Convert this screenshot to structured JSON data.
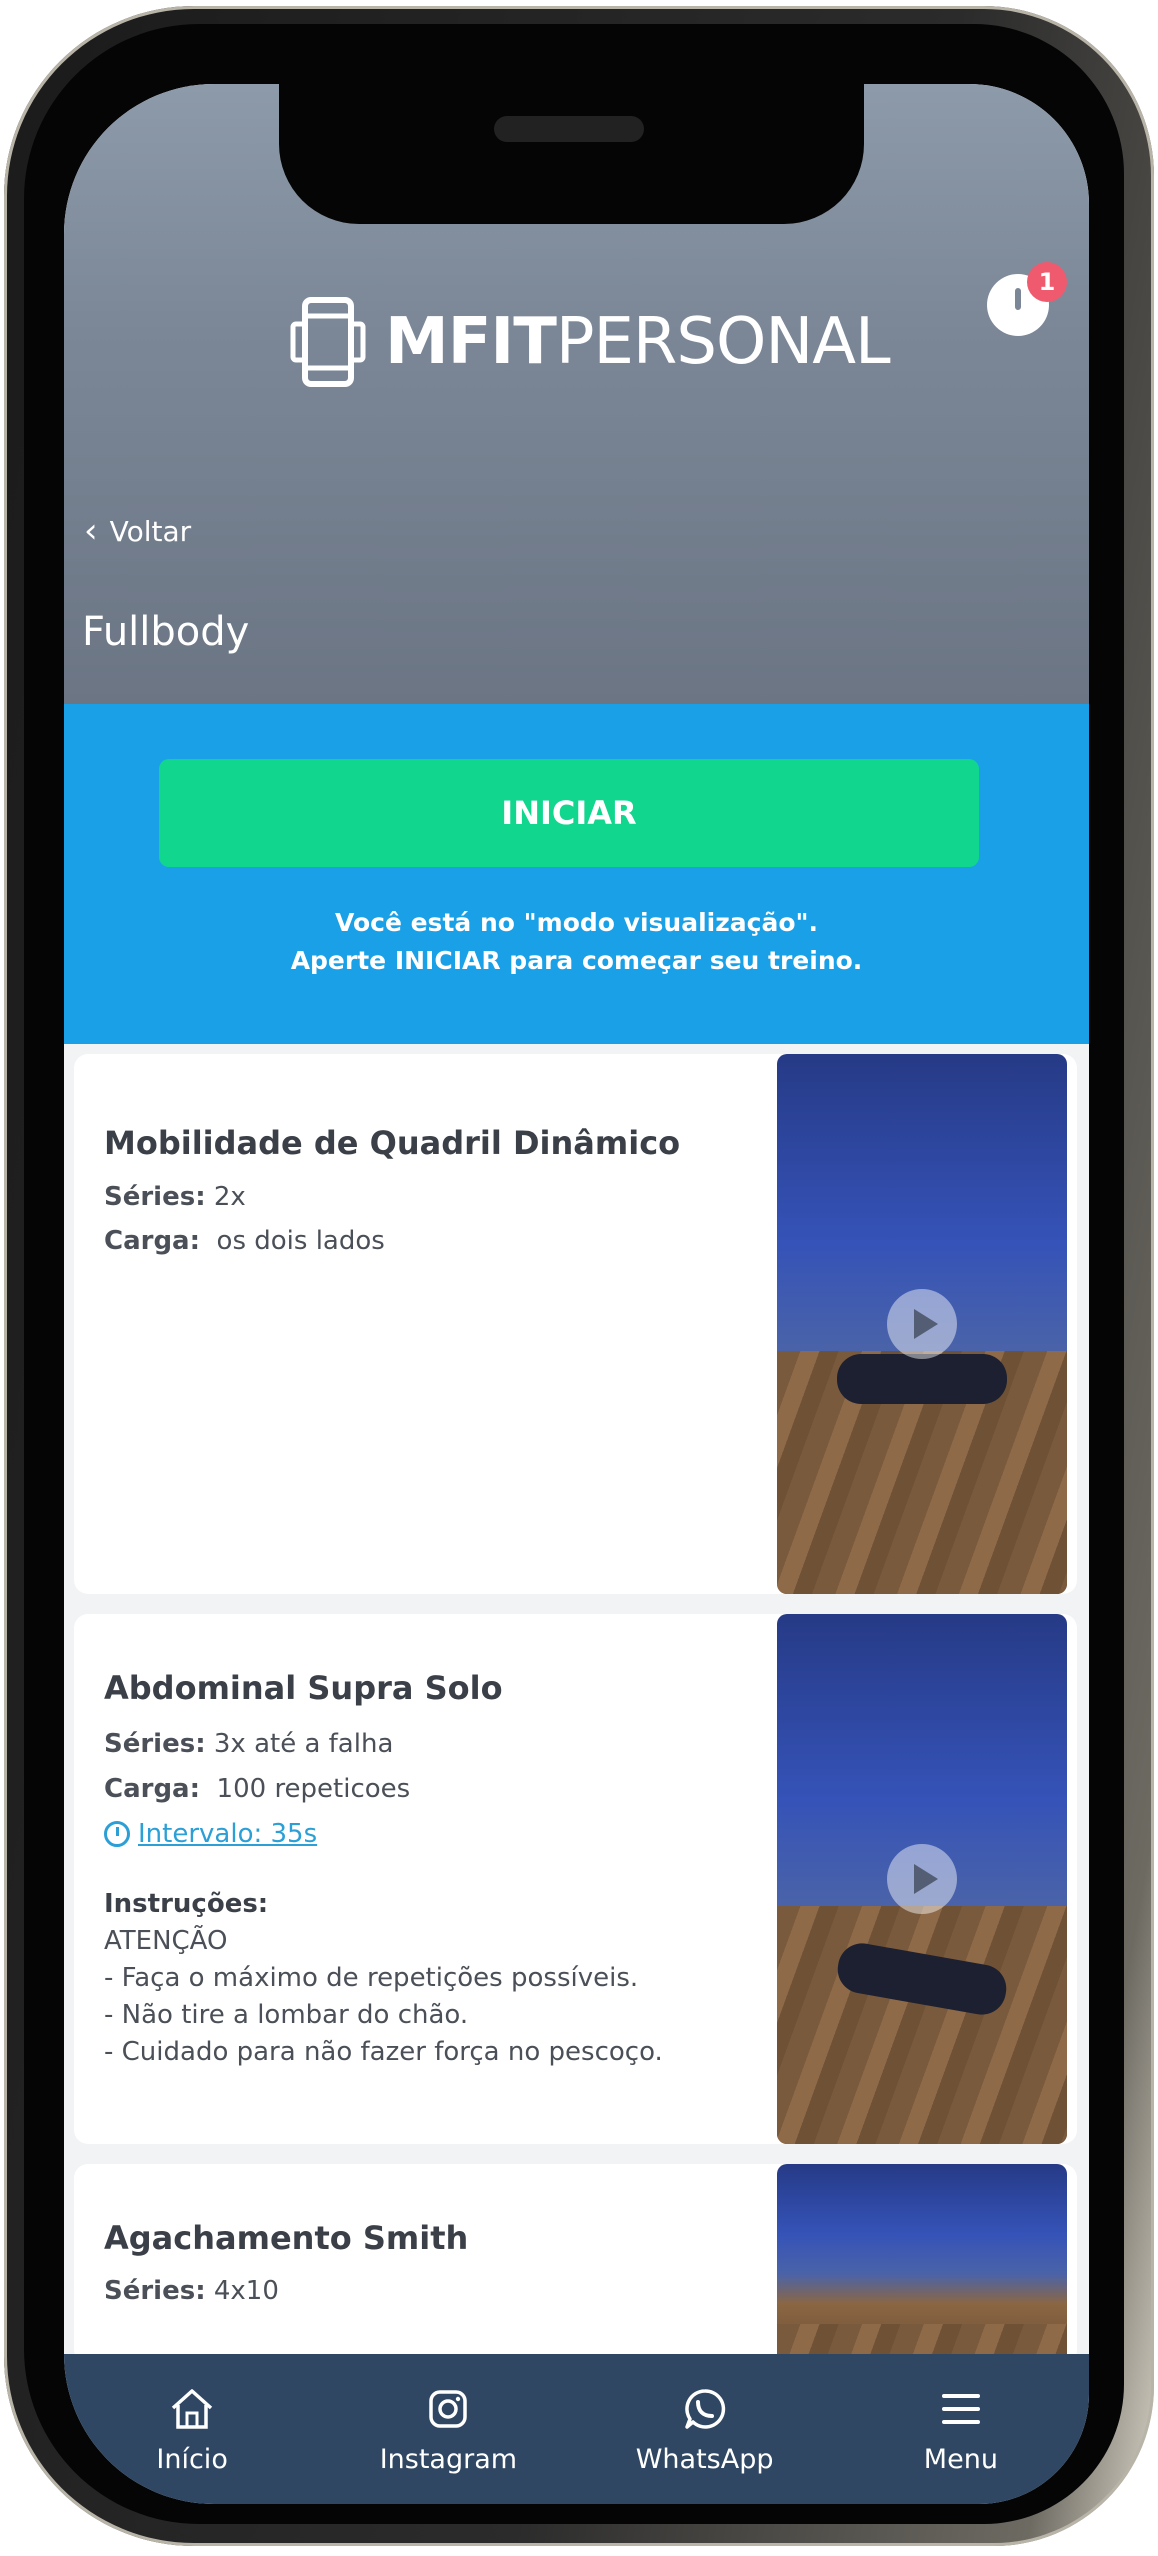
{
  "header": {
    "logo_bold": "MFIT",
    "logo_light": "PERSONAL",
    "notification_count": "1",
    "back_label": "Voltar",
    "page_title": "Fullbody"
  },
  "cta": {
    "start_label": "INICIAR",
    "message_line1": "Você está no \"modo visualização\".",
    "message_line2": "Aperte INICIAR para começar seu treino."
  },
  "exercises": [
    {
      "name": "Mobilidade de Quadril Dinâmico",
      "series_label": "Séries:",
      "series_value": "2x",
      "load_label": "Carga:",
      "load_value": "os dois lados"
    },
    {
      "name": "Abdominal Supra Solo",
      "series_label": "Séries:",
      "series_value": "3x até a falha",
      "load_label": "Carga:",
      "load_value": "100 repeticoes",
      "interval": "Intervalo: 35s",
      "instructions_label": "Instruções:",
      "instructions": [
        "ATENÇÃO",
        "- Faça o máximo de repetições possíveis.",
        "- Não tire a lombar do chão.",
        "- Cuidado para não fazer força no pescoço."
      ]
    },
    {
      "name": "Agachamento Smith",
      "series_label": "Séries:",
      "series_value": "4x10"
    }
  ],
  "nav": {
    "home": "Início",
    "instagram": "Instagram",
    "whatsapp": "WhatsApp",
    "menu": "Menu"
  },
  "colors": {
    "header_bg": "#7b8797",
    "cta_bg": "#1aa0e6",
    "start_button": "#11d68e",
    "nav_bg": "#2f4762",
    "link": "#2b9fd6",
    "badge": "#ef5a6f"
  }
}
